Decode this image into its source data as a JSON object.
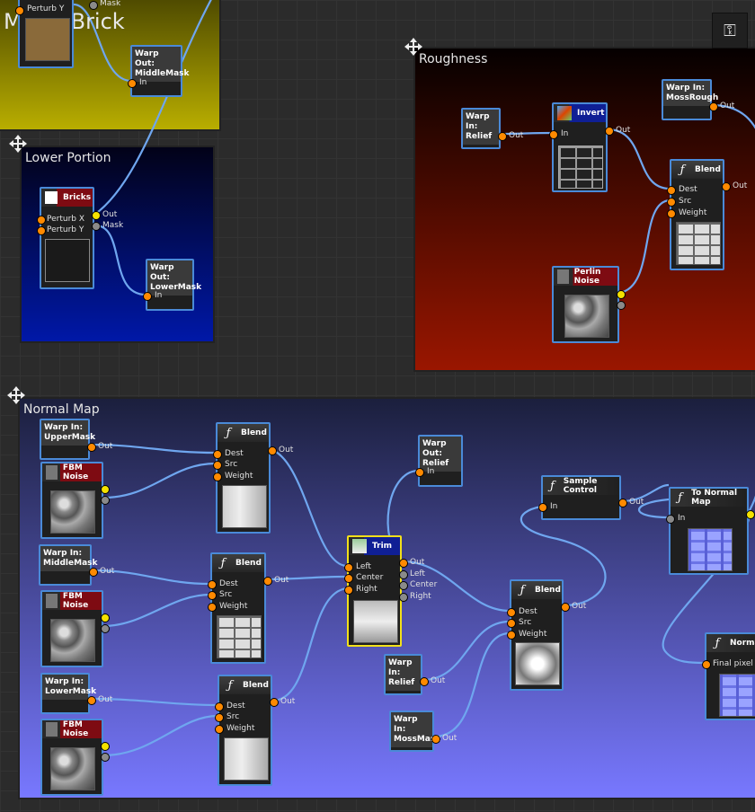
{
  "frames": {
    "mossy": "MossyBrick",
    "lower": "Lower Portion",
    "rough": "Roughness",
    "normal": "Normal Map"
  },
  "ports": {
    "in": "In",
    "out": "Out",
    "mask": "Mask",
    "perturb_x": "Perturb X",
    "perturb_y": "Perturb Y",
    "dest": "Dest",
    "src": "Src",
    "weight": "Weight",
    "left": "Left",
    "center": "Center",
    "right": "Right",
    "final_pixel": "Final pixel"
  },
  "nodes": {
    "warp_out_middle": "Warp Out:\nMiddleMask",
    "bricks": "Bricks",
    "warp_out_lower": "Warp Out:\nLowerMask",
    "warp_in_relief_r": "Warp In:\nRelief",
    "invert": "Invert",
    "warp_in_mossrough": "Warp In:\nMossRough",
    "blend": "Blend",
    "perlin": "Perlin Noise",
    "warp_in_upper": "Warp In:\nUpperMask",
    "fbm": "FBM Noise",
    "warp_in_middle": "Warp In:\nMiddleMask",
    "warp_in_lower": "Warp In:\nLowerMask",
    "warp_out_relief": "Warp Out:\nRelief",
    "trim": "Trim",
    "sample_control": "Sample Control",
    "to_normal_map": "To Normal Map",
    "warp_in_relief_n": "Warp In:\nRelief",
    "warp_in_mossmask": "Warp In:\nMossMask",
    "normal": "Normal"
  },
  "tool": {
    "icon": "key-icon",
    "glyph": "⚿"
  },
  "colors": {
    "mossy_frame": "#b9ae00",
    "lower_frame": "#0018a8",
    "rough_frame": "#9a1600",
    "normal_frame_top": "#1b1f3d",
    "normal_frame_bottom": "#7878ff",
    "wire": "#6fa6ef"
  }
}
